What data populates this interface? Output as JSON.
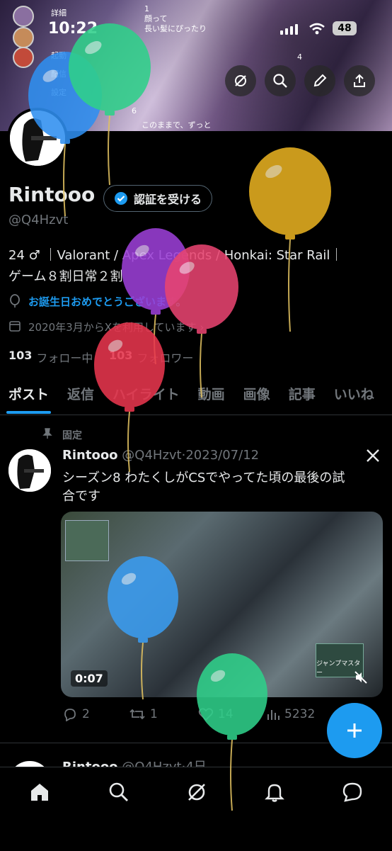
{
  "status_bar": {
    "time": "10:22",
    "battery": "48"
  },
  "banner": {
    "overlay_texts": [
      "詳細",
      "起動",
      "配信",
      "設定",
      "4",
      "顔って",
      "長い髪にぴったり",
      "1",
      "3",
      "6",
      "このままで、ずっと"
    ]
  },
  "profile": {
    "display_name": "Rintooo",
    "verify_button": "認証を受ける",
    "handle": "@Q4Hzvt",
    "bio_line1": "24 ♂ ｜Valorant / Apex Legends / Honkai: Star Rail｜",
    "bio_line2": "ゲーム８割日常２割",
    "birthday": "お誕生日おめでとうございます。",
    "joined": "2020年3月からXを利用しています",
    "following_count": "103",
    "following_label": "フォロー中",
    "followers_count": "103",
    "followers_label": "フォロワー"
  },
  "tabs": [
    "ポスト",
    "返信",
    "ハイライト",
    "動画",
    "画像",
    "記事",
    "いいね"
  ],
  "pinned_post": {
    "pinned_label": "固定",
    "author": "Rintooo",
    "handle": "@Q4Hzvt",
    "date": "2023/07/12",
    "text_line1": "シーズン8 わたくしがCSでやってた頃の最後の試",
    "text_line2": "合です",
    "video_time": "0:07",
    "video_overlay": "ジャンプマスター",
    "replies": "2",
    "reposts": "1",
    "likes": "14",
    "views": "5232"
  },
  "next_post": {
    "author": "Rintooo",
    "handle": "@Q4Hzvt",
    "date": "4日"
  },
  "colors": {
    "accent": "#1d9bf0",
    "muted": "#71767b",
    "text": "#e7e9ea",
    "background": "#000000"
  },
  "balloons": [
    {
      "color": "#2f8ff0"
    },
    {
      "color": "#2fd08a"
    },
    {
      "color": "#e6b020"
    },
    {
      "color": "#9b3fd6"
    },
    {
      "color": "#e84470"
    },
    {
      "color": "#e8364e"
    },
    {
      "color": "#3a9cf0"
    },
    {
      "color": "#2fd08a"
    }
  ]
}
